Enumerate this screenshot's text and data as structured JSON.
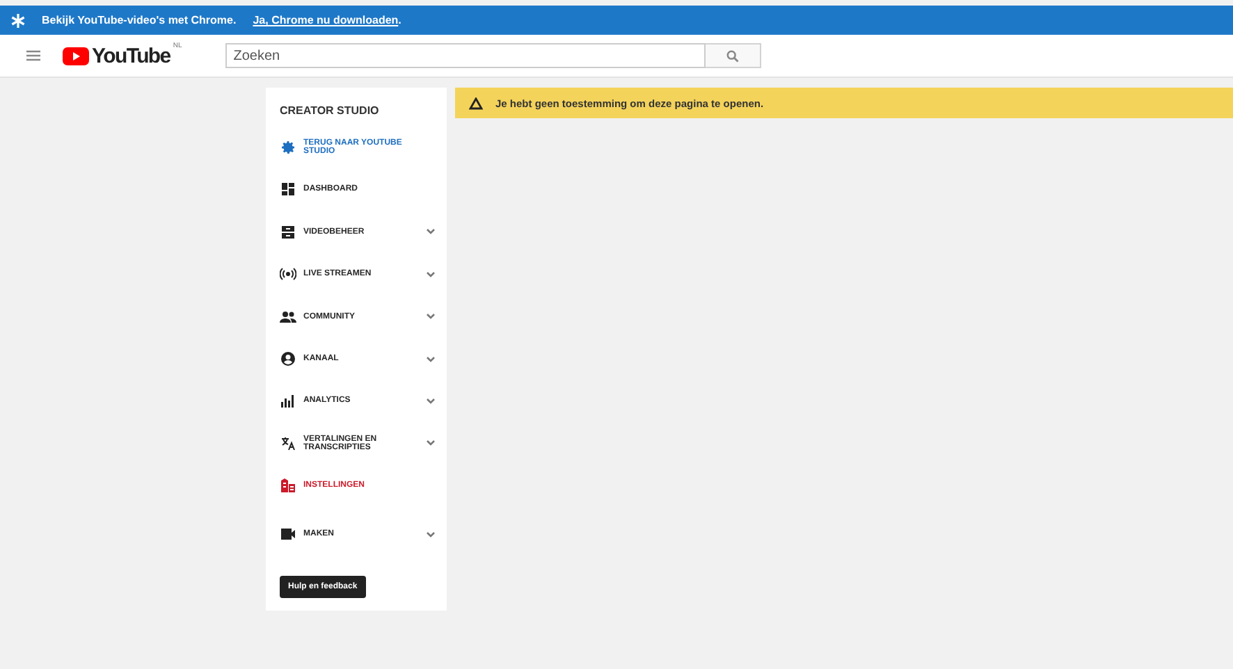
{
  "chrome_banner": {
    "message": "Bekijk YouTube-video's met Chrome.",
    "link": "Ja, Chrome nu downloaden",
    "suffix": "."
  },
  "header": {
    "logo": "YouTube",
    "region": "NL",
    "search": {
      "placeholder": "Zoeken"
    }
  },
  "sidebar": {
    "title": "CREATOR STUDIO",
    "items": [
      {
        "label": "TERUG NAAR YOUTUBE STUDIO",
        "expandable": false,
        "color": "#1e6fc0"
      },
      {
        "label": "DASHBOARD",
        "expandable": false,
        "color": "#282828"
      },
      {
        "label": "VIDEOBEHEER",
        "expandable": true,
        "color": "#282828"
      },
      {
        "label": "LIVE STREAMEN",
        "expandable": true,
        "color": "#282828"
      },
      {
        "label": "COMMUNITY",
        "expandable": true,
        "color": "#282828"
      },
      {
        "label": "KANAAL",
        "expandable": true,
        "color": "#282828"
      },
      {
        "label": "ANALYTICS",
        "expandable": true,
        "color": "#282828"
      },
      {
        "label": "VERTALINGEN EN TRANSCRIPTIES",
        "expandable": true,
        "color": "#282828"
      },
      {
        "label": "INSTELLINGEN",
        "expandable": false,
        "color": "#cc1a2a"
      },
      {
        "label": "MAKEN",
        "expandable": true,
        "color": "#282828"
      }
    ],
    "help_button": "Hulp en feedback"
  },
  "alert": {
    "message": "Je hebt geen toestemming om deze pagina te openen."
  }
}
